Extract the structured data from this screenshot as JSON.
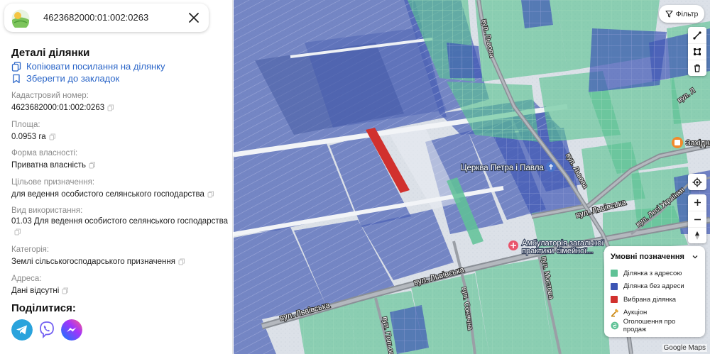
{
  "search": {
    "value": "4623682000:01:002:0263"
  },
  "details": {
    "title": "Деталі ділянки",
    "copy_link_label": "Копіювати посилання на ділянку",
    "bookmark_label": "Зберегти до закладок",
    "fields": [
      {
        "label": "Кадастровий номер:",
        "value": "4623682000:01:002:0263"
      },
      {
        "label": "Площа:",
        "value": "0.0953 га"
      },
      {
        "label": "Форма власності:",
        "value": "Приватна власність"
      },
      {
        "label": "Цільове призначення:",
        "value": "для ведення особистого селянського господарства"
      },
      {
        "label": "Вид використання:",
        "value": "01.03 Для ведення особистого селянського господарства"
      },
      {
        "label": "Категорія:",
        "value": "Землі сільськогосподарського призначення"
      },
      {
        "label": "Адреса:",
        "value": "Дані відсутні"
      }
    ]
  },
  "share": {
    "title": "Поділитися:",
    "items": [
      "telegram-icon",
      "viber-icon",
      "messenger-icon"
    ]
  },
  "map": {
    "filter_label": "Фільтр",
    "labels": {
      "church": "Церква Петра і Павла",
      "ambulatory_line1": "Амбулаторія загальної",
      "ambulatory_line2": "практики сімейної...",
      "street_lvivska_1": "вул. Львівська",
      "street_lvivska_2": "вул. Львівська",
      "street_lvivska_3": "вул. Львівська",
      "street_lvova": "вул. Львова",
      "street_lvova_2": "вул. Львова",
      "street_ukrainky": "вул. Лесі Українки",
      "street_vul": "вул. Л",
      "street_sonyachna": "вул. Сонячна",
      "street_polyova": "вул. Польова",
      "street_mostova": "вул. Мостова",
      "place_zakhid": "Західна",
      "credit": "Google Maps"
    },
    "legend": {
      "title": "Умовні позначення",
      "items": [
        {
          "label": "Ділянка з адресою",
          "color": "#5fc296"
        },
        {
          "label": "Ділянка без адреси",
          "color": "#3c55b4"
        },
        {
          "label": "Вибрана ділянка",
          "color": "#d1312e"
        },
        {
          "label": "Аукціон",
          "icon": "auction-icon"
        },
        {
          "label": "Оголошення про продаж",
          "icon": "sale-icon"
        }
      ]
    }
  },
  "colors": {
    "link": "#2a65c8",
    "with_address": "#5fc296",
    "without_address": "#3c55b4",
    "selected": "#d1312e"
  }
}
